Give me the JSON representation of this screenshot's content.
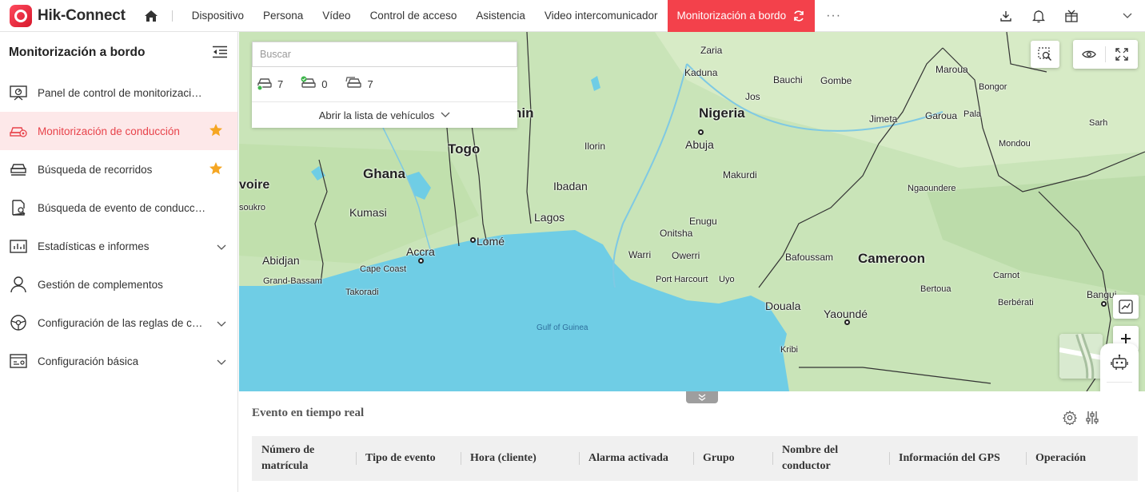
{
  "app": {
    "name": "Hik-Connect"
  },
  "nav": {
    "items": [
      "Dispositivo",
      "Persona",
      "Vídeo",
      "Control de acceso",
      "Asistencia",
      "Video intercomunicador"
    ],
    "active": "Monitorización a bordo",
    "more": "···"
  },
  "sidebar": {
    "title": "Monitorización a bordo",
    "items": [
      {
        "label": "Panel de control de monitorización a bordo",
        "icon": "dashboard-icon"
      },
      {
        "label": "Monitorización de conducción",
        "icon": "driving-monitor-icon",
        "active": true,
        "starred": true
      },
      {
        "label": "Búsqueda de recorridos",
        "icon": "route-search-icon",
        "starred": true
      },
      {
        "label": "Búsqueda de evento de conducción",
        "icon": "event-search-icon"
      },
      {
        "label": "Estadísticas e informes",
        "icon": "stats-icon",
        "expandable": true
      },
      {
        "label": "Gestión de complementos",
        "icon": "person-icon"
      },
      {
        "label": "Configuración de las reglas de conducción",
        "icon": "rules-icon",
        "expandable": true
      },
      {
        "label": "Configuración básica",
        "icon": "basic-config-icon",
        "expandable": true
      }
    ]
  },
  "vehicle_panel": {
    "search_placeholder": "Buscar",
    "stats": {
      "online": "7",
      "active": "0",
      "total": "7"
    },
    "open_list": "Abrir la lista de vehículos"
  },
  "map": {
    "countries": [
      "Nigeria",
      "Ghana",
      "Togo",
      "Cameroon",
      "voire",
      "nin"
    ],
    "sea": "Gulf of Guinea",
    "cities": [
      "Zaria",
      "Kaduna",
      "Bauchi",
      "Gombe",
      "Maroua",
      "Bongor",
      "Jos",
      "Jimeta",
      "Garoua",
      "Pala",
      "Sarh",
      "Abuja",
      "Ilorin",
      "Mondou",
      "Makurdi",
      "Ibadan",
      "Ngaoundere",
      "Lagos",
      "Enugu",
      "Onitsha",
      "Kumasi",
      "Lomé",
      "Warri",
      "Owerri",
      "Bafoussam",
      "Carnot",
      "Abidjan",
      "Accra",
      "Cape Coast",
      "Port Harcourt",
      "Uyo",
      "Grand-Bassam",
      "Bertoua",
      "Takoradi",
      "Douala",
      "Berbérati",
      "Yaoundé",
      "Bangui",
      "Kribi",
      "soukro"
    ]
  },
  "events": {
    "title": "Evento en tiempo real",
    "columns": [
      "Número de matrícula",
      "Tipo de evento",
      "Hora (cliente)",
      "Alarma activada",
      "Grupo",
      "Nombre del conductor",
      "Información del GPS",
      "Operación"
    ]
  },
  "colors": {
    "accent": "#f3414b",
    "active_bg": "#fde8e9",
    "star": "#f5a623",
    "water": "#6fcde5",
    "land": "#c5e2b4"
  }
}
